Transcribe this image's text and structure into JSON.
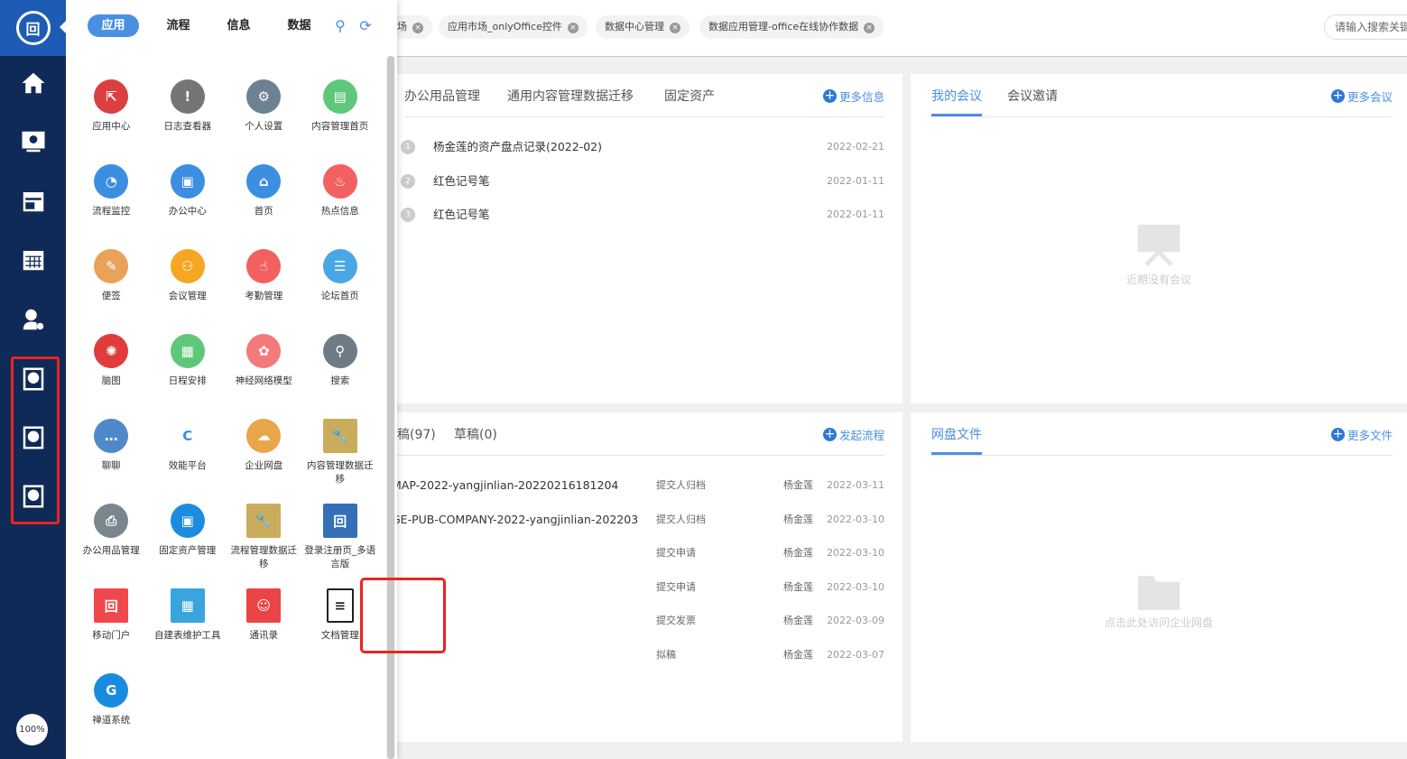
{
  "sidebar": {
    "items": [
      "home-icon",
      "office-icon",
      "calendar-news-icon",
      "calendar-icon",
      "user-settings-icon",
      "web-doc-1-icon",
      "web-doc-2-icon",
      "web-doc-3-icon"
    ],
    "zoom": "100%"
  },
  "apps_panel": {
    "tabs": [
      "应用",
      "流程",
      "信息",
      "数据"
    ],
    "items": [
      {
        "label": "应用中心",
        "color": "#db4040"
      },
      {
        "label": "日志查看器",
        "color": "#757575"
      },
      {
        "label": "个人设置",
        "color": "#6e8190"
      },
      {
        "label": "内容管理首页",
        "color": "#5fc77a"
      },
      {
        "label": "流程监控",
        "color": "#3c8ee0"
      },
      {
        "label": "办公中心",
        "color": "#3c8ee0"
      },
      {
        "label": "首页",
        "color": "#3c8ee0"
      },
      {
        "label": "热点信息",
        "color": "#f36060"
      },
      {
        "label": "便签",
        "color": "#e8a25a"
      },
      {
        "label": "会议管理",
        "color": "#f5a623"
      },
      {
        "label": "考勤管理",
        "color": "#f36060"
      },
      {
        "label": "论坛首页",
        "color": "#4aa7e6"
      },
      {
        "label": "脑图",
        "color": "#e03c3c"
      },
      {
        "label": "日程安排",
        "color": "#5fc77a"
      },
      {
        "label": "神经网络模型",
        "color": "#f37a7a"
      },
      {
        "label": "搜索",
        "color": "#6e7c86"
      },
      {
        "label": "聊聊",
        "color": "#4f89c9"
      },
      {
        "label": "效能平台",
        "color": "#ffffff"
      },
      {
        "label": "企业网盘",
        "color": "#e8a54a"
      },
      {
        "label": "内容管理数据迁移",
        "color": "#c9ad5d"
      },
      {
        "label": "办公用品管理",
        "color": "#7a868e"
      },
      {
        "label": "固定资产管理",
        "color": "#1c8ce0"
      },
      {
        "label": "流程管理数据迁移",
        "color": "#c9ad5d"
      },
      {
        "label": "登录注册页_多语言版",
        "color": "#3470b8"
      },
      {
        "label": "移动门户",
        "color": "#f0474c"
      },
      {
        "label": "自建表维护工具",
        "color": "#3aa4dd"
      },
      {
        "label": "通讯录",
        "color": "#ea4447"
      },
      {
        "label": "文档管理",
        "color": "#ffffff"
      },
      {
        "label": "禅道系统",
        "color": "#1a8ce0"
      }
    ]
  },
  "tabs_bar": {
    "tabs": [
      "场",
      "应用市场_onlyOffice控件",
      "数据中心管理",
      "数据应用管理-office在线协作数据"
    ],
    "search_placeholder": "请输入搜索关键"
  },
  "info_panel": {
    "tabs": [
      "办公用品管理",
      "通用内容管理数据迁移",
      "固定资产"
    ],
    "more": "更多信息",
    "rows": [
      {
        "n": "1",
        "title": "杨金莲的资产盘点记录(2022-02)",
        "date": "2022-02-21"
      },
      {
        "n": "2",
        "title": "红色记号笔",
        "date": "2022-01-11"
      },
      {
        "n": "3",
        "title": "红色记号笔",
        "date": "2022-01-11"
      }
    ]
  },
  "meeting_panel": {
    "tabs": [
      "我的会议",
      "会议邀请"
    ],
    "more": "更多会议",
    "empty": "近期没有会议"
  },
  "flow_panel": {
    "tabs": [
      "稿(97)",
      "草稿(0)"
    ],
    "more": "发起流程",
    "rows": [
      {
        "title": "MAP-2022-yangjinlian-20220216181204",
        "status": "提交人归档",
        "user": "杨金莲",
        "date": "2022-03-11"
      },
      {
        "title": "GE-PUB-COMPANY-2022-yangjinlian-202203",
        "status": "提交人归档",
        "user": "杨金莲",
        "date": "2022-03-10"
      },
      {
        "title": "",
        "status": "提交申请",
        "user": "杨金莲",
        "date": "2022-03-10"
      },
      {
        "title": "",
        "status": "提交申请",
        "user": "杨金莲",
        "date": "2022-03-10"
      },
      {
        "title": "",
        "status": "提交发票",
        "user": "杨金莲",
        "date": "2022-03-09"
      },
      {
        "title": "",
        "status": "拟稿",
        "user": "杨金莲",
        "date": "2022-03-07"
      }
    ]
  },
  "disk_panel": {
    "tabs": [
      "网盘文件"
    ],
    "more": "更多文件",
    "empty": "点击此处访问企业网盘"
  }
}
